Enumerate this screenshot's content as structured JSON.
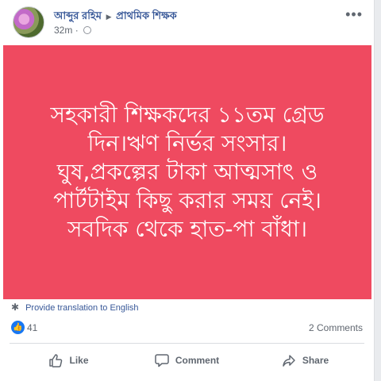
{
  "post": {
    "author": "আব্দুর রহিম",
    "group": "প্রাথমিক শিক্ষক",
    "time": "32m",
    "text_lines": [
      "সহকারী শিক্ষকদের ১১তম গ্রেড",
      "দিন।ঋণ নির্ভর সংসার।",
      "ঘুষ,প্রকল্পের টাকা আত্মসাৎ ও",
      "পার্টটাইম কিছু করার সময় নেই।",
      "সবদিক থেকে হাত-পা বাঁধা।"
    ],
    "background_color": "#ef4a60"
  },
  "translate_label": "Provide translation to English",
  "reactions": {
    "like_count": "41",
    "comments": "2 Comments"
  },
  "actions": {
    "like": "Like",
    "comment": "Comment",
    "share": "Share"
  }
}
